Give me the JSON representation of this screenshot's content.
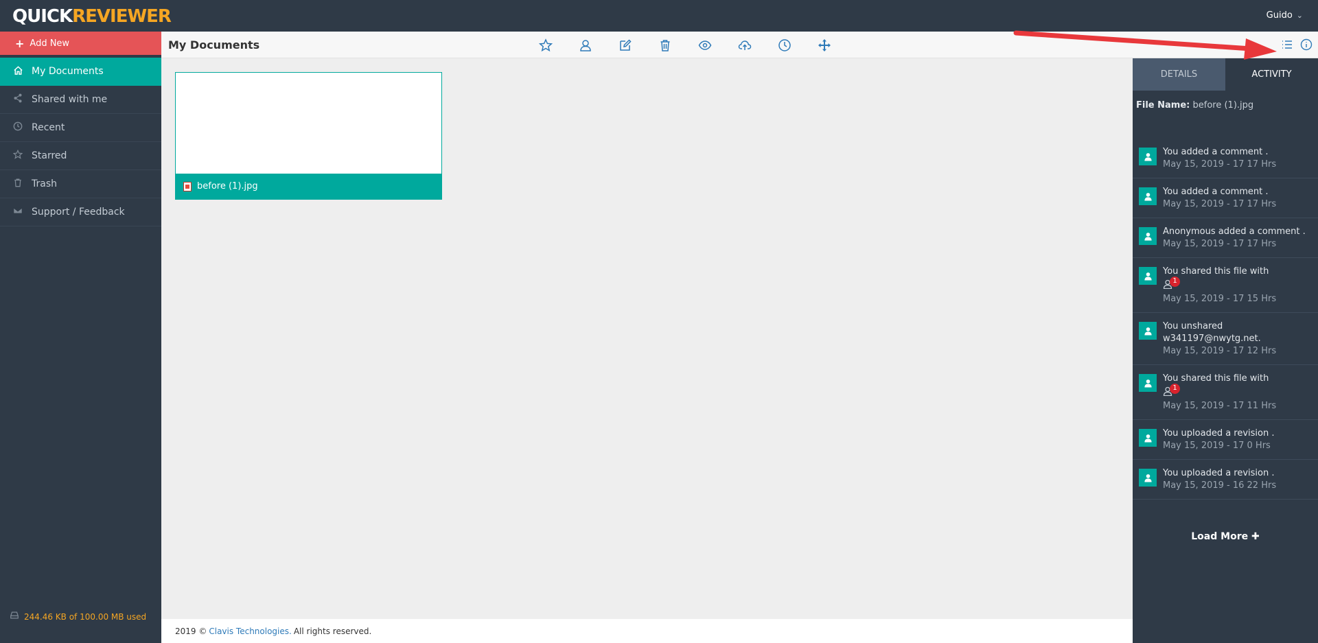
{
  "app": {
    "logo_part1": "QUICK",
    "logo_part2": "REVIEWER",
    "user_name": "Guido"
  },
  "sidebar": {
    "add_new_label": "Add New",
    "items": [
      {
        "label": "My Documents",
        "icon": "home-icon",
        "active": true
      },
      {
        "label": "Shared with me",
        "icon": "share-icon"
      },
      {
        "label": "Recent",
        "icon": "clock-icon"
      },
      {
        "label": "Starred",
        "icon": "star-icon"
      },
      {
        "label": "Trash",
        "icon": "trash-icon"
      },
      {
        "label": "Support / Feedback",
        "icon": "envelope-icon"
      }
    ],
    "storage_text": "244.46 KB of 100.00 MB used"
  },
  "header": {
    "title": "My Documents",
    "toolbar": [
      "star-icon",
      "user-icon",
      "edit-icon",
      "trash-icon",
      "eye-icon",
      "upload-cloud-icon",
      "clock-icon",
      "move-icon"
    ],
    "right_icons": [
      "list-icon",
      "info-icon"
    ]
  },
  "main": {
    "files": [
      {
        "name": "before (1).jpg"
      }
    ]
  },
  "footer": {
    "prefix": "2019 ©",
    "company": "Clavis Technologies.",
    "suffix": "All rights reserved."
  },
  "panel": {
    "tabs": [
      {
        "label": "DETAILS"
      },
      {
        "label": "ACTIVITY",
        "active": true
      }
    ],
    "file_name_label": "File Name:",
    "file_name_value": "before (1).jpg",
    "activities": [
      {
        "text": "You added a comment .",
        "time": "May 15, 2019 - 17 17 Hrs"
      },
      {
        "text": "You added a comment .",
        "time": "May 15, 2019 - 17 17 Hrs"
      },
      {
        "text": "Anonymous added a comment .",
        "time": "May 15, 2019 - 17 17 Hrs"
      },
      {
        "text": "You shared this file with",
        "badge": "1",
        "time": "May 15, 2019 - 17 15 Hrs"
      },
      {
        "text": "You unshared w341197@nwytg.net.",
        "time": "May 15, 2019 - 17 12 Hrs"
      },
      {
        "text": "You shared this file with",
        "badge": "1",
        "time": "May 15, 2019 - 17 11 Hrs"
      },
      {
        "text": "You uploaded a revision .",
        "time": "May 15, 2019 - 17 0 Hrs"
      },
      {
        "text": "You uploaded a revision .",
        "time": "May 15, 2019 - 16 22 Hrs"
      }
    ],
    "load_more_label": "Load More"
  },
  "colors": {
    "accent": "#00a99d",
    "sidebar_bg": "#2f3a47",
    "add_new": "#e55457",
    "storage_text": "#f5a623",
    "annotation_arrow": "#e8383b"
  }
}
